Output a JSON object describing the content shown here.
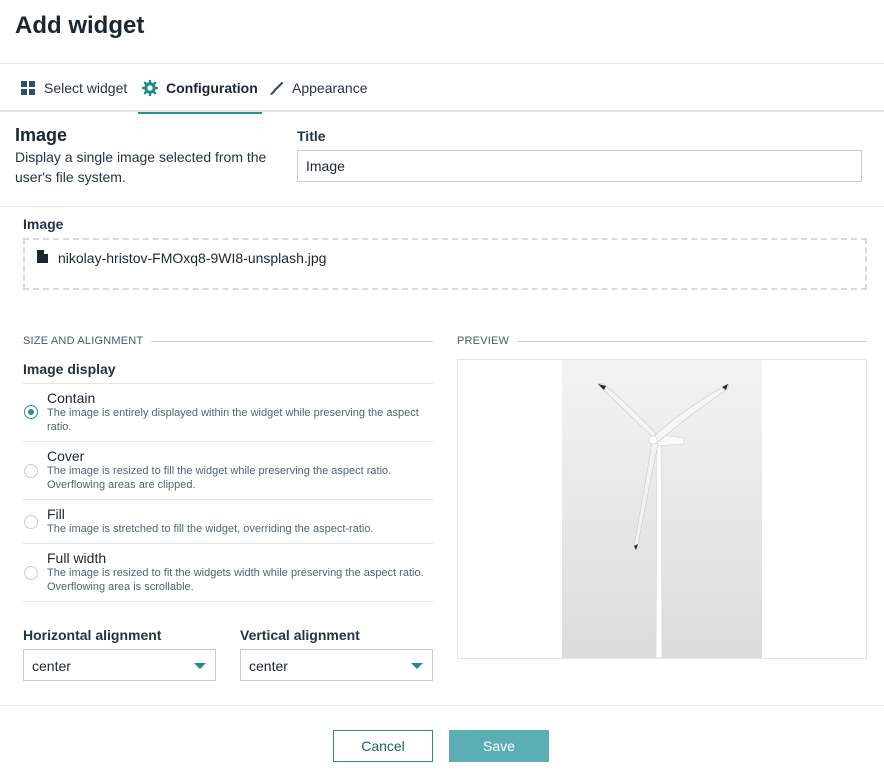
{
  "dialog": {
    "title": "Add widget"
  },
  "tabs": [
    {
      "label": "Select widget",
      "icon": "grid-icon",
      "active": false
    },
    {
      "label": "Configuration",
      "icon": "gear-icon",
      "active": true
    },
    {
      "label": "Appearance",
      "icon": "brush-icon",
      "active": false
    }
  ],
  "widget": {
    "name": "Image",
    "description": "Display a single image selected from the user's file system."
  },
  "title_field": {
    "label": "Title",
    "value": "Image"
  },
  "image_field": {
    "label": "Image",
    "file_name": "nikolay-hristov-FMOxq8-9WI8-unsplash.jpg",
    "icon": "file-icon"
  },
  "size_alignment": {
    "heading": "SIZE AND ALIGNMENT",
    "display_label": "Image display",
    "selected": "Contain",
    "options": [
      {
        "name": "Contain",
        "description": "The image is entirely displayed within the widget while preserving the aspect ratio."
      },
      {
        "name": "Cover",
        "description": "The image is resized to fill the widget while preserving the aspect ratio. Overflowing areas are clipped."
      },
      {
        "name": "Fill",
        "description": "The image is stretched to fill the widget, overriding the aspect-ratio."
      },
      {
        "name": "Full width",
        "description": "The image is resized to fit the widgets width while preserving the aspect ratio. Overflowing area is scrollable."
      }
    ],
    "horizontal": {
      "label": "Horizontal alignment",
      "value": "center"
    },
    "vertical": {
      "label": "Vertical alignment",
      "value": "center"
    }
  },
  "preview": {
    "heading": "PREVIEW"
  },
  "footer": {
    "cancel_label": "Cancel",
    "save_label": "Save"
  },
  "colors": {
    "accent": "#2b8f95",
    "save_button": "#5aaeb4",
    "text": "#1d2630"
  }
}
